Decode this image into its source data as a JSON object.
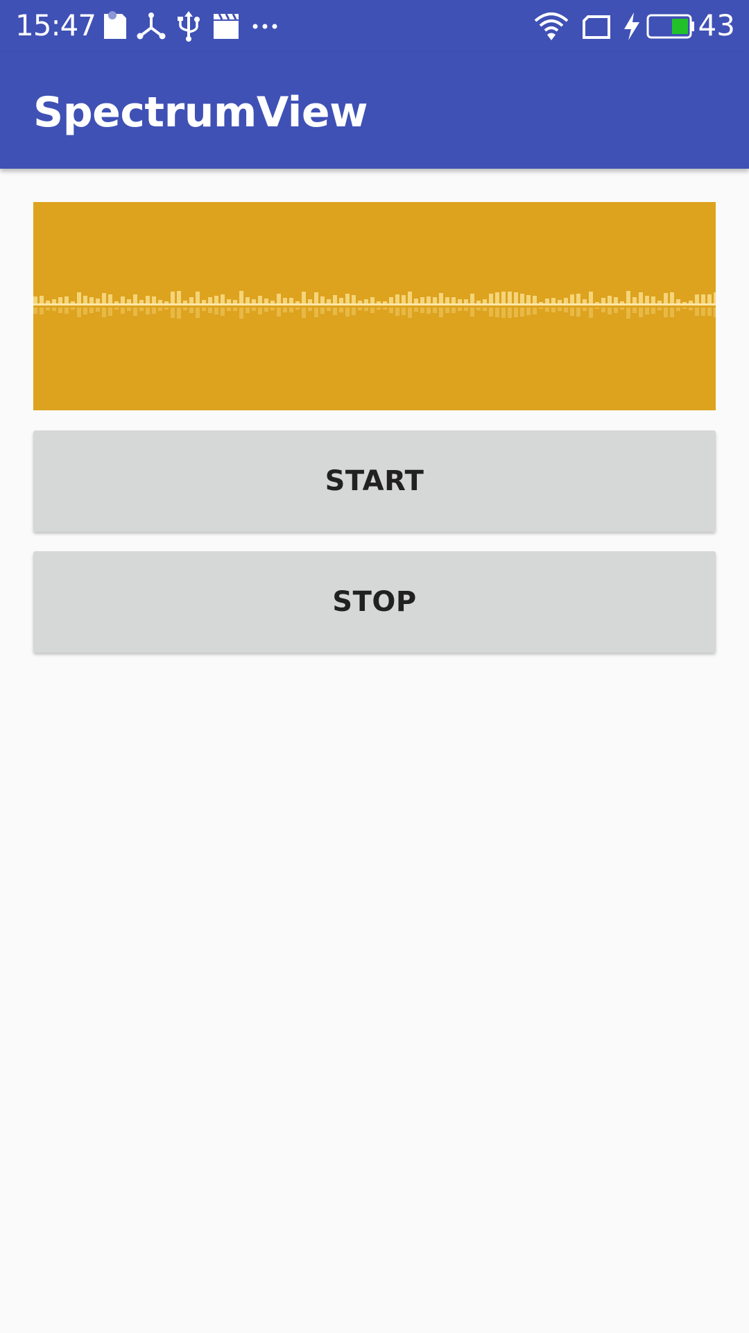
{
  "status_bar": {
    "time": "15:47",
    "battery_level": "43",
    "icons_left": [
      "sd-card-icon",
      "network-share-icon",
      "usb-icon",
      "clapperboard-icon",
      "more-dots-icon"
    ],
    "icons_right": [
      "wifi-icon",
      "sim-card-icon",
      "charging-bolt-icon",
      "battery-icon"
    ]
  },
  "app_bar": {
    "title": "SpectrumView"
  },
  "spectrum": {
    "background_color": "#DDA21E",
    "bar_color": "#F5D57A",
    "baseline_color": "#FBE7A8"
  },
  "buttons": {
    "start_label": "START",
    "stop_label": "STOP"
  },
  "colors": {
    "primary": "#3F51B5",
    "page_background": "#FAFAFA",
    "button_background": "#D6D7D7",
    "button_text": "#212121"
  }
}
